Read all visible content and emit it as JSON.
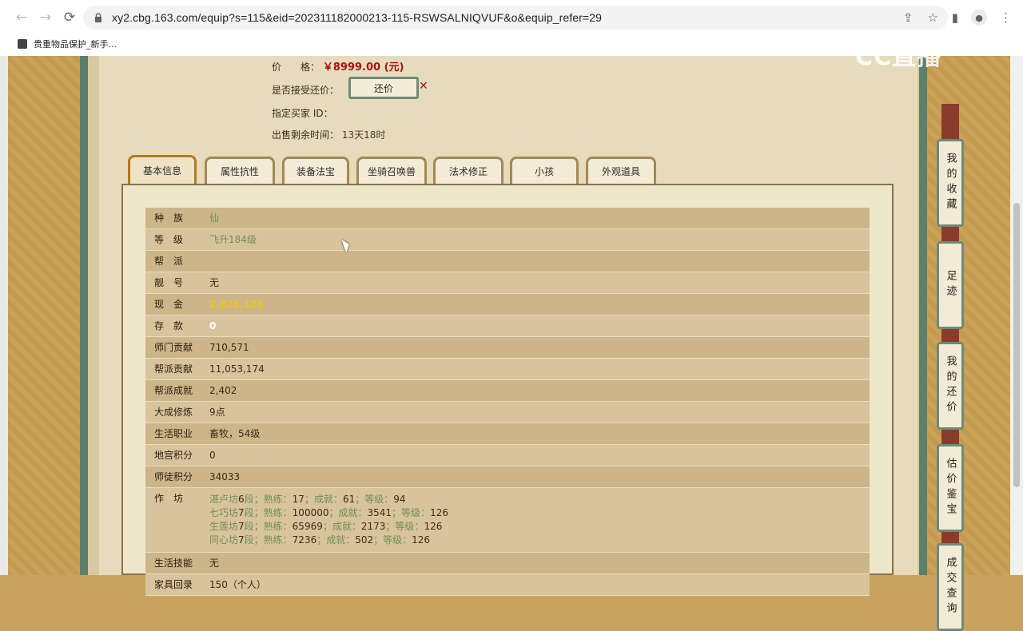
{
  "browser": {
    "url": "xy2.cbg.163.com/equip?s=115&eid=202311182000213-115-RSWSALNIQVUF&o&equip_refer=29",
    "bookmark_label": "贵重物品保护_新手..."
  },
  "watermark": "CC直播",
  "header": {
    "price_label": "价　　格：",
    "price_value": "￥8999.00 (元)",
    "bargain_label": "是否接受还价：",
    "bargain_button": "还价",
    "buyer_id_label": "指定买家 ID：",
    "remaining_label": "出售剩余时间：",
    "remaining_value": "13天18时"
  },
  "tabs": [
    "基本信息",
    "属性抗性",
    "装备法宝",
    "坐骑召唤兽",
    "法术修正",
    "小孩",
    "外观道具"
  ],
  "info": {
    "race": {
      "k": "种　族",
      "v": "仙"
    },
    "level": {
      "k": "等　级",
      "v": "飞升184级"
    },
    "guild": {
      "k": "帮　派",
      "v": ""
    },
    "nickname": {
      "k": "靓　号",
      "v": "无"
    },
    "cash": {
      "k": "现　金",
      "v": "2,821,128"
    },
    "deposit": {
      "k": "存　款",
      "v": "0"
    },
    "school_contrib": {
      "k": "师门贡献",
      "v": "710,571"
    },
    "guild_contrib": {
      "k": "帮派贡献",
      "v": "11,053,174"
    },
    "guild_achieve": {
      "k": "帮派成就",
      "v": "2,402"
    },
    "cultivation": {
      "k": "大成修炼",
      "v": "9点"
    },
    "life_job": {
      "k": "生活职业",
      "v": "畜牧，54级"
    },
    "palace_points": {
      "k": "地宫积分",
      "v": "0"
    },
    "mentor_points": {
      "k": "师徒积分",
      "v": "34033"
    },
    "workshop_key": "作　坊",
    "workshops": [
      {
        "name": "湛卢坊",
        "tier": "6",
        "seg": "段；熟练：",
        "skill": "17",
        "ach_l": "；成就：",
        "ach": "61",
        "lvl_l": "；等级：",
        "lvl": "94"
      },
      {
        "name": "七巧坊",
        "tier": "7",
        "seg": "段；熟练：",
        "skill": "100000",
        "ach_l": "；成就：",
        "ach": "3541",
        "lvl_l": "；等级：",
        "lvl": "126"
      },
      {
        "name": "生莲坊",
        "tier": "7",
        "seg": "段；熟练：",
        "skill": "65969",
        "ach_l": "；成就：",
        "ach": "2173",
        "lvl_l": "；等级：",
        "lvl": "126"
      },
      {
        "name": "同心坊",
        "tier": "7",
        "seg": "段；熟练：",
        "skill": "7236",
        "ach_l": "；成就：",
        "ach": "502",
        "lvl_l": "；等级：",
        "lvl": "126"
      }
    ],
    "life_skill": {
      "k": "生活技能",
      "v": "无"
    },
    "home": {
      "k": "家具回录",
      "v": "150（个人）"
    }
  },
  "sidebar": [
    "我的收藏",
    "足迹",
    "我的还价",
    "估价鉴宝",
    "成交查询"
  ]
}
